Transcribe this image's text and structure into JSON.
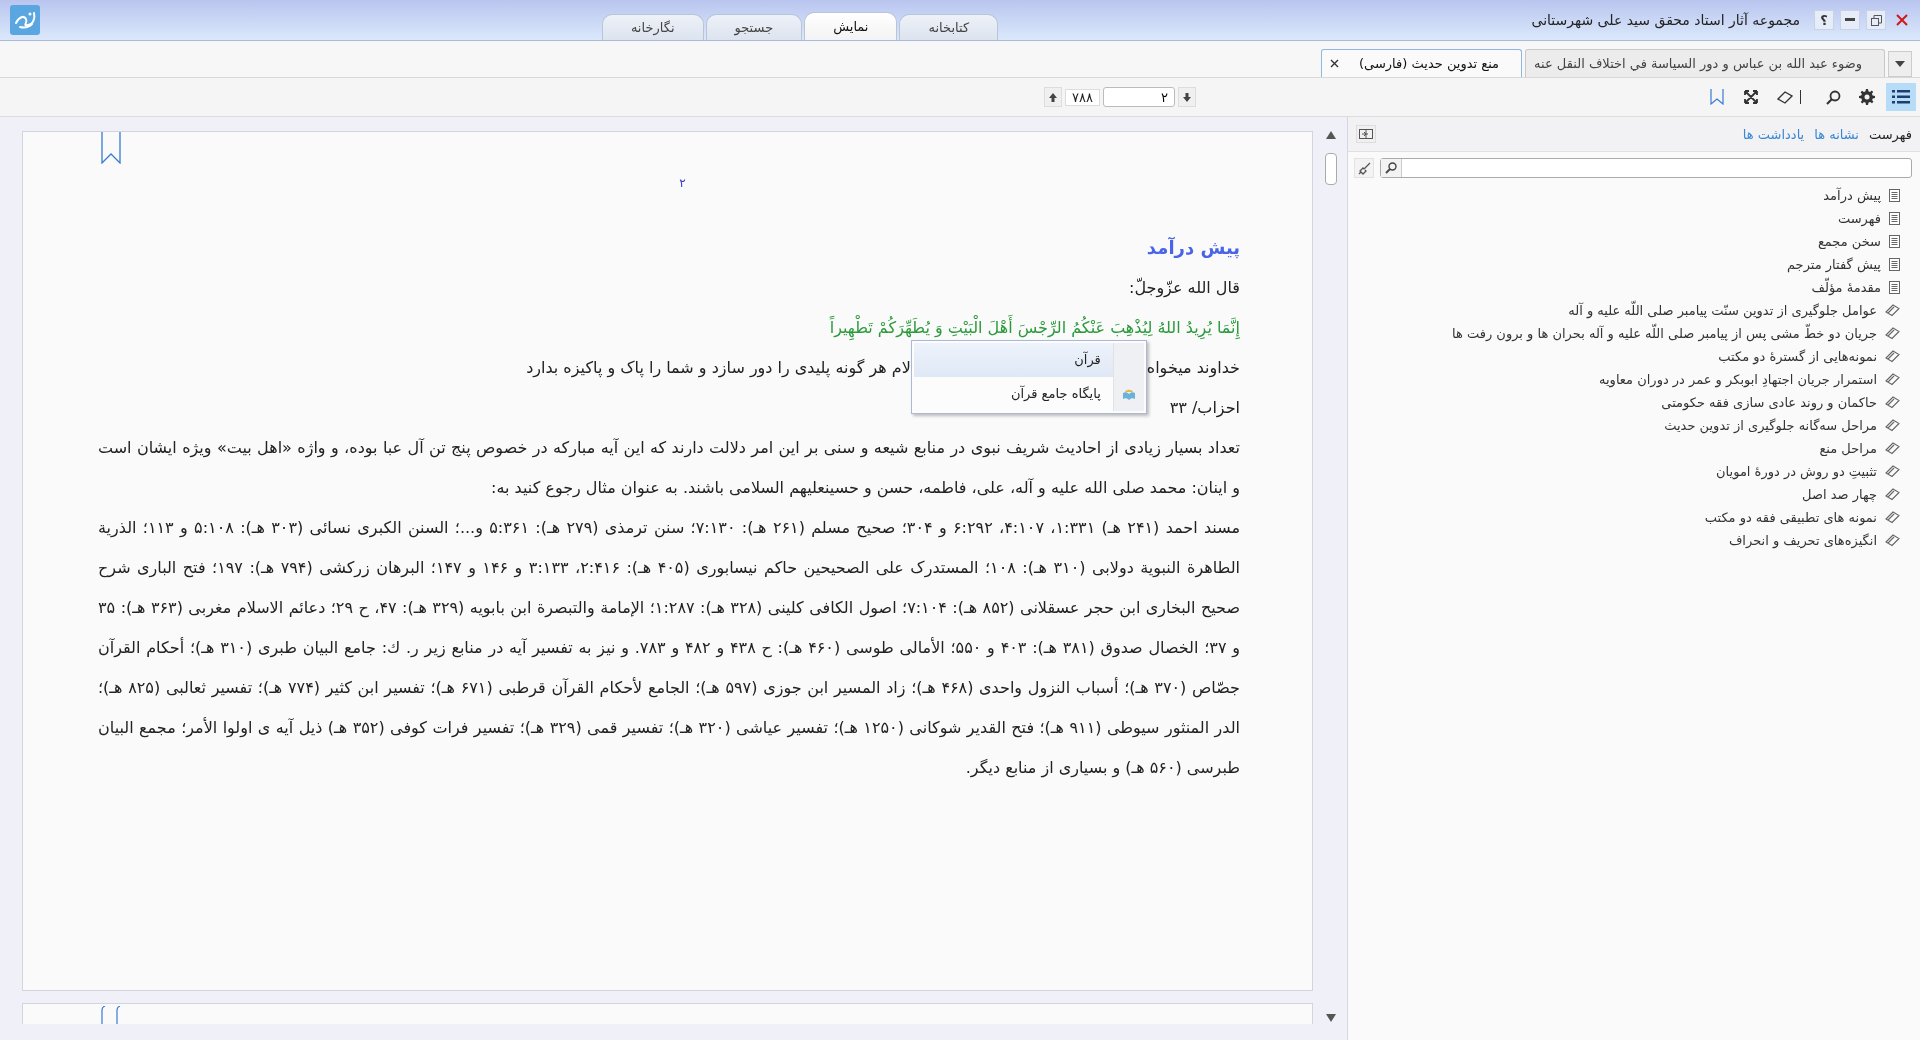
{
  "window": {
    "title": "مجموعه آثار استاد محقق سید علی شهرستانی",
    "help": "؟"
  },
  "main_tabs": [
    {
      "label": "کتابخانه",
      "selected": false
    },
    {
      "label": "نمایش",
      "selected": true
    },
    {
      "label": "جستجو",
      "selected": false
    },
    {
      "label": "نگارخانه",
      "selected": false
    }
  ],
  "document_tabs": [
    {
      "label": "وضوء عبد الله بن عباس و دور السياسة في اختلاف النقل عنه",
      "selected": false
    },
    {
      "label": "منع تدوین حدیث (فارسی)",
      "selected": true
    }
  ],
  "toolbar": {
    "buttons": [
      {
        "kind": "list",
        "active": true
      },
      {
        "kind": "gear",
        "active": false
      },
      {
        "kind": "search",
        "active": false
      },
      {
        "kind": "eraser",
        "active": false
      },
      {
        "kind": "fullscreen",
        "active": false
      },
      {
        "kind": "bookmark",
        "active": false
      }
    ],
    "page_field": "۲",
    "page_total": "۷۸۸"
  },
  "sidebar": {
    "tabs": [
      {
        "label": "فهرست",
        "selected": true
      },
      {
        "label": "نشانه ها",
        "selected": false
      },
      {
        "label": "یادداشت ها",
        "selected": false
      }
    ],
    "items": [
      {
        "label": "پیش درآمد",
        "kind": "page"
      },
      {
        "label": "فهرست",
        "kind": "page"
      },
      {
        "label": "سخن مجمع",
        "kind": "page"
      },
      {
        "label": "پیش گفتار مترجم",
        "kind": "page"
      },
      {
        "label": "مقدمۀ مؤلّف",
        "kind": "page"
      },
      {
        "label": "عوامل جلوگیری از تدوین سنّت پیامبر صلی اللّه علیه و آله",
        "kind": "book"
      },
      {
        "label": "جریان دو خطّ مشی پس از پیامبر صلی اللّه علیه و آله بحران ها و برون رفت ها",
        "kind": "book"
      },
      {
        "label": "نمونه‌هایی از گسترۀ دو مکتب",
        "kind": "book"
      },
      {
        "label": "استمرار جریان اجتهادِ ابوبکر و عمر در دوران معاویه",
        "kind": "book"
      },
      {
        "label": "حاکمان و روند عادی سازی فقه حکومتی",
        "kind": "book"
      },
      {
        "label": "مراحل سه‌گانه جلوگیری از تدوین حدیث",
        "kind": "book"
      },
      {
        "label": "مراحل منع",
        "kind": "book"
      },
      {
        "label": "تثبیتِ دو روش در دورۀ امویان",
        "kind": "book"
      },
      {
        "label": "چهار صد اصل",
        "kind": "book"
      },
      {
        "label": "نمونه های تطبیقی فقه دو مکتب",
        "kind": "book"
      },
      {
        "label": "انگیزه‌های تحریف و انحراف",
        "kind": "book"
      }
    ]
  },
  "page": {
    "number": "۲",
    "heading": "پیش درآمد",
    "intro": "قال الله عزّوجلّ:",
    "verse": "إِنَّمَا يُرِيدُ اللهُ لِيُذْهِبَ عَنْكُمُ الرِّجْسَ أَهْلَ الْبَيْتِ وَ يُطَهِّرَكُمْ تَطْهِيراً",
    "translation": [
      "خداوند میخواه",
      "لام هر گونه پلیدی را دور سازد و شما را پاک و پاکیزه بدارد"
    ],
    "reference": "احزاب/ ۳۳",
    "paragraphs": [
      "تعداد بسیار زیادی از احادیث شریف نبوی در منابع شیعه و سنی بر این امر دلالت دارند که این آیه مبارکه در خصوص پنج تن آل عبا بوده، و واژه «اهل بیت» ویژه ایشان است و اینان: محمد صلی الله علیه و آله، علی، فاطمه، حسن و حسینعلیهم السلامی باشند. به عنوان مثال رجوع کنید به:",
      "مسند احمد (۲۴۱ هـ) ۱:۳۳۱، ۴:۱۰۷، ۶:۲۹۲ و ۳۰۴؛ صحیح مسلم (۲۶۱ هـ): ۷:۱۳۰؛ سنن ترمذی (۲۷۹ هـ): ۵:۳۶۱ و...؛ السنن الکبری نسائی (۳۰۳ هـ): ۵:۱۰۸ و ۱۱۳؛ الذریة الطاهرة النبویة دولابی (۳۱۰ هـ): ۱۰۸؛ المستدرک علی الصحیحین حاکم نیسابوری (۴۰۵ هـ): ۲:۴۱۶، ۳:۱۳۳ و ۱۴۶ و ۱۴۷؛ البرهان زرکشی (۷۹۴ هـ): ۱۹۷؛ فتح الباری شرح صحیح البخاری ابن حجر عسقلانی (۸۵۲ هـ): ۷:۱۰۴؛ اصول الکافی کلینی (۳۲۸ هـ): ۱:۲۸۷؛ الإمامة والتبصرة ابن بابویه (۳۲۹ هـ): ۴۷، ح ۲۹؛ دعائم الاسلام مغربی (۳۶۳ هـ): ۳۵ و ۳۷؛ الخصال صدوق (۳۸۱ هـ): ۴۰۳ و ۵۵۰؛ الأمالی طوسی (۴۶۰ هـ): ح ۴۳۸ و ۴۸۲ و ۷۸۳. و نیز به تفسیر آیه در منابع زیر ر. ك: جامع البیان طبری (۳۱۰ هـ)؛ أحکام القرآن جصّاص (۳۷۰ هـ)؛ أسباب النزول واحدی (۴۶۸ هـ)؛ زاد المسیر ابن جوزی (۵۹۷ هـ)؛ الجامع لأحکام القرآن قرطبی (۶۷۱ هـ)؛ تفسیر ابن کثیر (۷۷۴ هـ)؛ تفسیر ثعالبی (۸۲۵ هـ)؛ الدر المنثور سیوطی (۹۱۱ هـ)؛ فتح القدیر شوکانی (۱۲۵۰ هـ)؛ تفسیر عیاشی (۳۲۰ هـ)؛ تفسیر قمی (۳۲۹ هـ)؛ تفسیر فرات کوفی (۳۵۲ هـ) ذیل آیه ی اولوا الأمر؛ مجمع البیان طبرسی (۵۶۰ هـ) و بسیاری از منابع دیگر."
    ]
  },
  "context_menu": [
    {
      "label": "قرآن",
      "kind": "plain",
      "highlighted": true
    },
    {
      "label": "پایگاه جامع قرآن",
      "kind": "app",
      "highlighted": false
    }
  ]
}
